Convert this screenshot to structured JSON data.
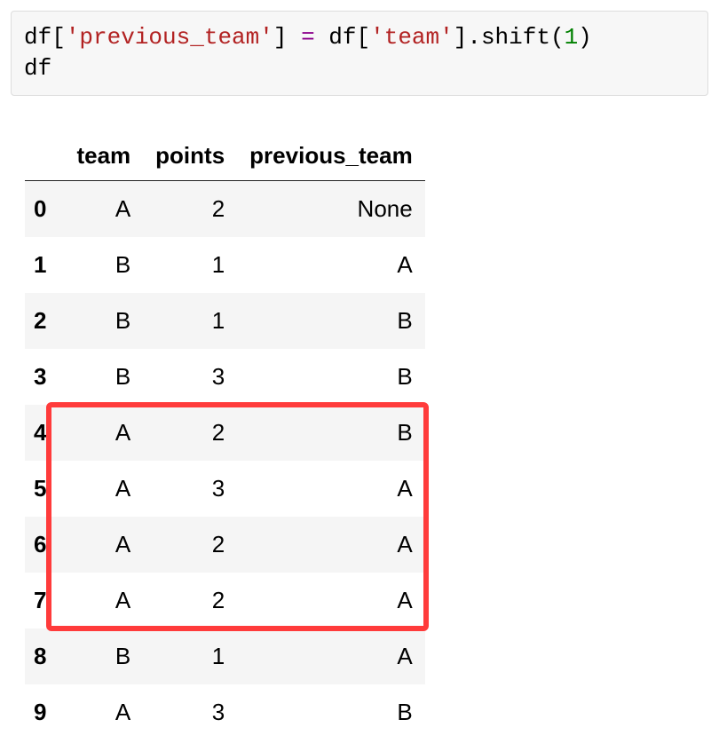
{
  "code": {
    "line1_parts": {
      "p1": "df[",
      "p2": "'previous_team'",
      "p3": "] ",
      "op": "=",
      "p4": " df[",
      "p5": "'team'",
      "p6": "].shift(",
      "num": "1",
      "p7": ")"
    },
    "line2": "df"
  },
  "table": {
    "columns": [
      "team",
      "points",
      "previous_team"
    ],
    "index": [
      "0",
      "1",
      "2",
      "3",
      "4",
      "5",
      "6",
      "7",
      "8",
      "9"
    ],
    "rows": [
      {
        "team": "A",
        "points": "2",
        "previous_team": "None"
      },
      {
        "team": "B",
        "points": "1",
        "previous_team": "A"
      },
      {
        "team": "B",
        "points": "1",
        "previous_team": "B"
      },
      {
        "team": "B",
        "points": "3",
        "previous_team": "B"
      },
      {
        "team": "A",
        "points": "2",
        "previous_team": "B"
      },
      {
        "team": "A",
        "points": "3",
        "previous_team": "A"
      },
      {
        "team": "A",
        "points": "2",
        "previous_team": "A"
      },
      {
        "team": "A",
        "points": "2",
        "previous_team": "A"
      },
      {
        "team": "B",
        "points": "1",
        "previous_team": "A"
      },
      {
        "team": "A",
        "points": "3",
        "previous_team": "B"
      }
    ]
  },
  "highlight": {
    "row_start": 4,
    "row_end": 7,
    "col_start": 1,
    "col_end": 3
  }
}
